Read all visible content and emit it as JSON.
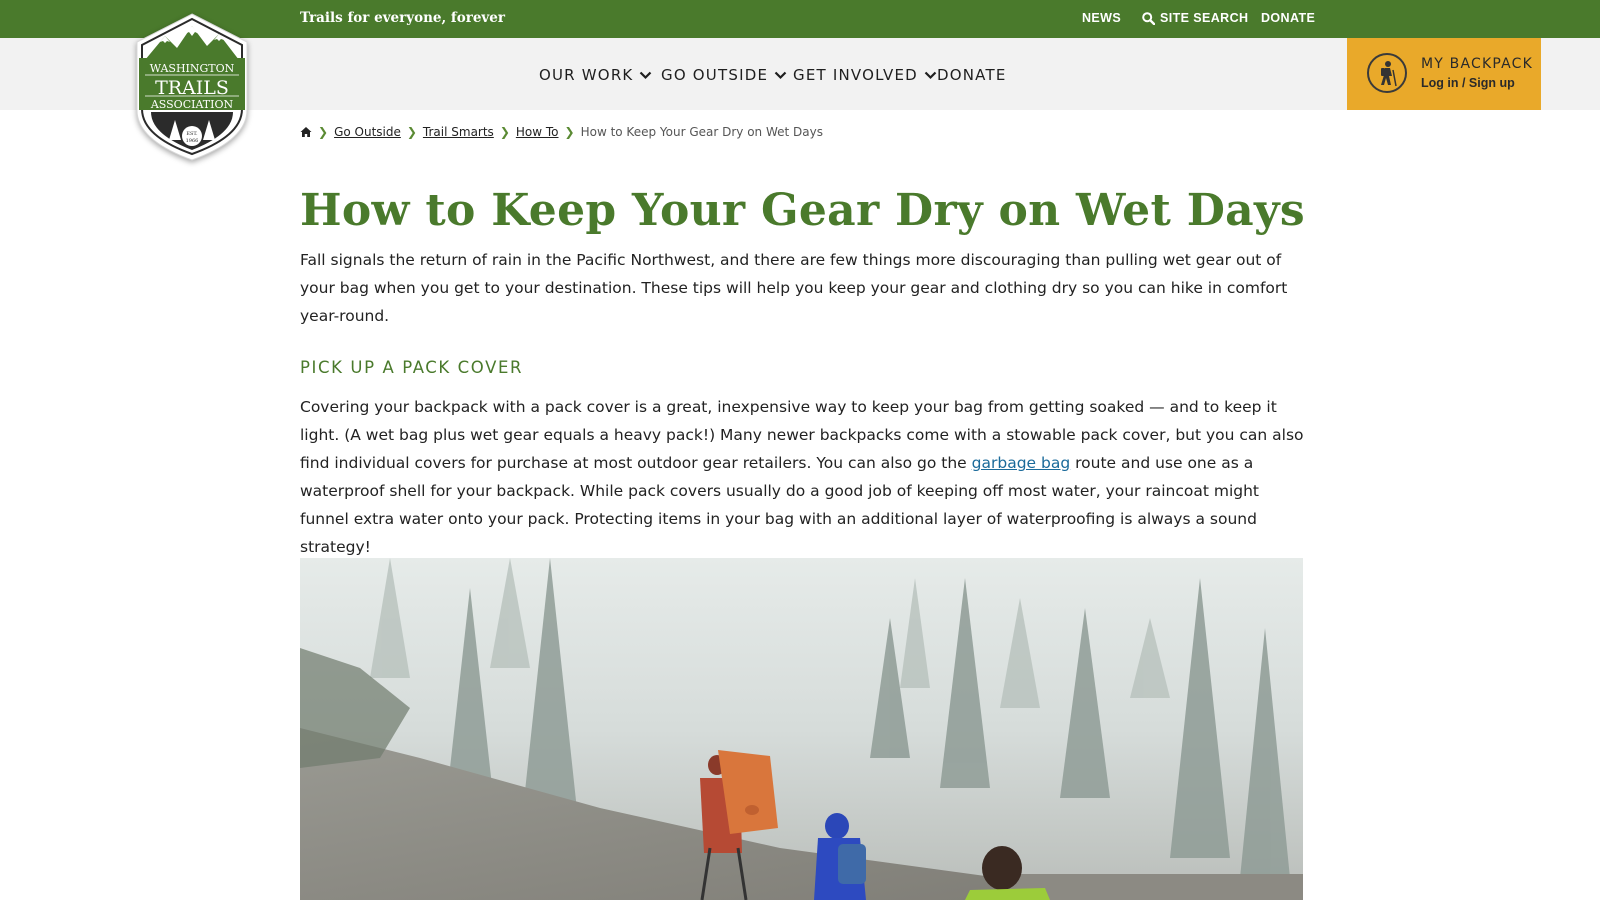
{
  "topbar": {
    "tagline": "Trails for everyone, forever",
    "links": {
      "news": "NEWS",
      "site_search": "SITE SEARCH",
      "donate": "DONATE"
    }
  },
  "logo": {
    "line1": "WASHINGTON",
    "line2": "TRAILS",
    "line3": "ASSOCIATION",
    "est": "EST.",
    "year": "1966"
  },
  "nav": {
    "items": [
      {
        "label": "OUR WORK",
        "has_dropdown": true
      },
      {
        "label": "GO OUTSIDE",
        "has_dropdown": true
      },
      {
        "label": "GET INVOLVED",
        "has_dropdown": true
      },
      {
        "label": "DONATE",
        "has_dropdown": false
      }
    ]
  },
  "backpack": {
    "title": "MY BACKPACK",
    "subtitle": "Log in / Sign up"
  },
  "breadcrumb": {
    "home_icon": "home-icon",
    "items": [
      "Go Outside",
      "Trail Smarts",
      "How To"
    ],
    "current": "How to Keep Your Gear Dry on Wet Days"
  },
  "article": {
    "title": "How to Keep Your Gear Dry on Wet Days",
    "intro": "Fall signals the return of rain in the Pacific Northwest, and there are few things more discouraging than pulling wet gear out of your bag when you get to your destination. These tips will help you keep your gear and clothing dry so you can hike in comfort year-round.",
    "section1": {
      "heading": "PICK UP A PACK COVER",
      "text_before_link": "Covering your backpack with a pack cover is a great, inexpensive way to keep your bag from getting soaked — and to keep it light. (A wet bag plus wet gear equals a heavy pack!) Many newer backpacks come with a stowable pack cover, but you can also find individual covers for purchase at most outdoor gear retailers. You can also go the ",
      "link_text": "garbage bag",
      "text_after_link": " route and use one as a waterproof shell for your backpack. While pack covers usually do a good job of keeping off most water, your raincoat might funnel extra water onto your pack. Protecting items in your bag with an additional layer of waterproofing is always a sound strategy!"
    }
  },
  "colors": {
    "brand_green": "#4a7a2c",
    "backpack_gold": "#e9a92a",
    "nav_bg": "#f2f2f2",
    "link_blue": "#1a6a9a"
  }
}
